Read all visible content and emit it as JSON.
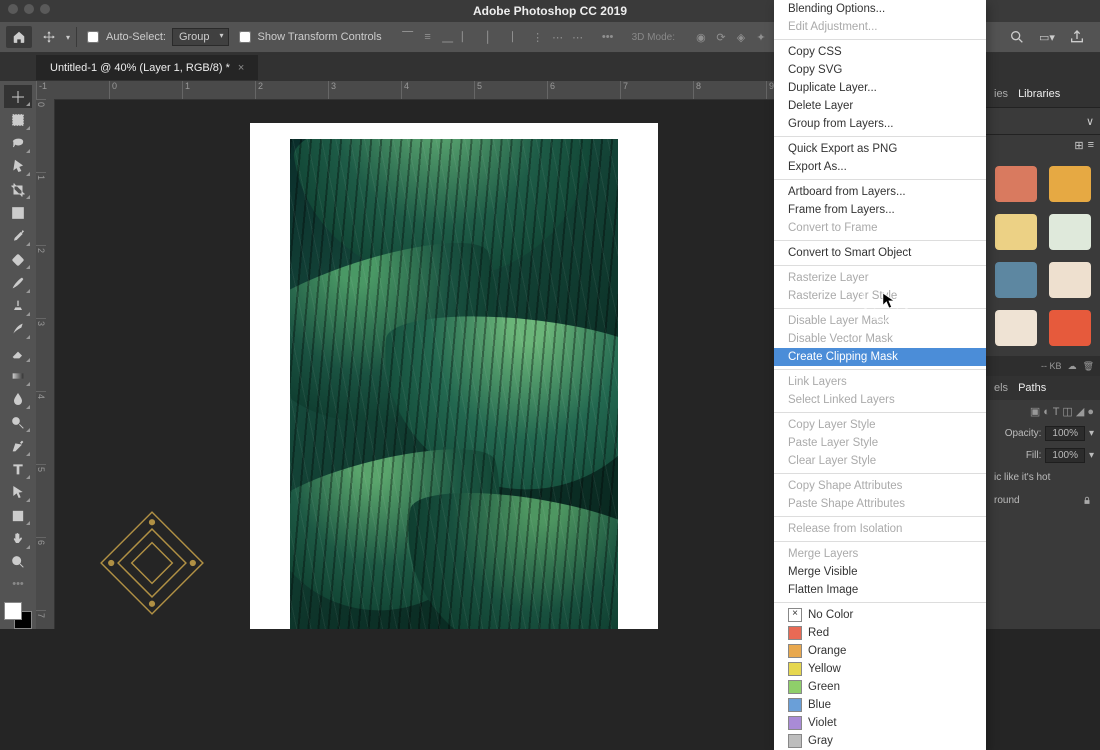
{
  "app": {
    "title": "Adobe Photoshop CC 2019"
  },
  "document": {
    "tab": "Untitled-1 @ 40% (Layer 1, RGB/8) *"
  },
  "options_bar": {
    "auto_select": "Auto-Select:",
    "group": "Group",
    "show_transform": "Show Transform Controls",
    "mode3d": "3D Mode:"
  },
  "ruler_h": [
    "-1",
    "0",
    "1",
    "2",
    "3",
    "4",
    "5",
    "6",
    "7",
    "8",
    "9"
  ],
  "ruler_v": [
    "0",
    "1",
    "2",
    "3",
    "4",
    "5",
    "6",
    "7"
  ],
  "context_menu": {
    "items": [
      {
        "label": "Blending Options...",
        "enabled": true
      },
      {
        "label": "Edit Adjustment...",
        "enabled": false
      },
      {
        "sep": true
      },
      {
        "label": "Copy CSS",
        "enabled": true
      },
      {
        "label": "Copy SVG",
        "enabled": true
      },
      {
        "label": "Duplicate Layer...",
        "enabled": true
      },
      {
        "label": "Delete Layer",
        "enabled": true
      },
      {
        "label": "Group from Layers...",
        "enabled": true
      },
      {
        "sep": true
      },
      {
        "label": "Quick Export as PNG",
        "enabled": true
      },
      {
        "label": "Export As...",
        "enabled": true
      },
      {
        "sep": true
      },
      {
        "label": "Artboard from Layers...",
        "enabled": true
      },
      {
        "label": "Frame from Layers...",
        "enabled": true
      },
      {
        "label": "Convert to Frame",
        "enabled": false
      },
      {
        "sep": true
      },
      {
        "label": "Convert to Smart Object",
        "enabled": true
      },
      {
        "sep": true
      },
      {
        "label": "Rasterize Layer",
        "enabled": false
      },
      {
        "label": "Rasterize Layer Style",
        "enabled": false
      },
      {
        "sep": true
      },
      {
        "label": "Disable Layer Mask",
        "enabled": false
      },
      {
        "label": "Disable Vector Mask",
        "enabled": false
      },
      {
        "label": "Create Clipping Mask",
        "enabled": true,
        "hover": true
      },
      {
        "sep": true
      },
      {
        "label": "Link Layers",
        "enabled": false
      },
      {
        "label": "Select Linked Layers",
        "enabled": false
      },
      {
        "sep": true
      },
      {
        "label": "Copy Layer Style",
        "enabled": false
      },
      {
        "label": "Paste Layer Style",
        "enabled": false
      },
      {
        "label": "Clear Layer Style",
        "enabled": false
      },
      {
        "sep": true
      },
      {
        "label": "Copy Shape Attributes",
        "enabled": false
      },
      {
        "label": "Paste Shape Attributes",
        "enabled": false
      },
      {
        "sep": true
      },
      {
        "label": "Release from Isolation",
        "enabled": false
      },
      {
        "sep": true
      },
      {
        "label": "Merge Layers",
        "enabled": false
      },
      {
        "label": "Merge Visible",
        "enabled": true
      },
      {
        "label": "Flatten Image",
        "enabled": true
      },
      {
        "sep": true
      }
    ],
    "colors": [
      {
        "name": "No Color",
        "hex": "#ffffff",
        "x": true
      },
      {
        "name": "Red",
        "hex": "#e86a55"
      },
      {
        "name": "Orange",
        "hex": "#e8a84e"
      },
      {
        "name": "Yellow",
        "hex": "#e6d74f"
      },
      {
        "name": "Green",
        "hex": "#8fcf6a"
      },
      {
        "name": "Blue",
        "hex": "#6a9fd8"
      },
      {
        "name": "Violet",
        "hex": "#a98bd6"
      },
      {
        "name": "Gray",
        "hex": "#bdbdbd"
      }
    ]
  },
  "panels": {
    "libraries_tab": "Libraries",
    "swatches": [
      {
        "hex": "#d97a5f"
      },
      {
        "hex": "#e6a943"
      },
      {
        "hex": "#ecd185"
      },
      {
        "hex": "#dfe9db"
      },
      {
        "hex": "#5d87a1"
      },
      {
        "hex": "#eee0cf"
      },
      {
        "hex": "#efe3d4"
      },
      {
        "hex": "#e65a3c"
      }
    ],
    "size": "-- KB",
    "layers_tab1": "els",
    "layers_tab2": "Paths",
    "opacity_label": "Opacity:",
    "opacity_val": "100%",
    "fill_label": "Fill:",
    "fill_val": "100%",
    "hot": "ic like it's hot",
    "round": "round"
  }
}
